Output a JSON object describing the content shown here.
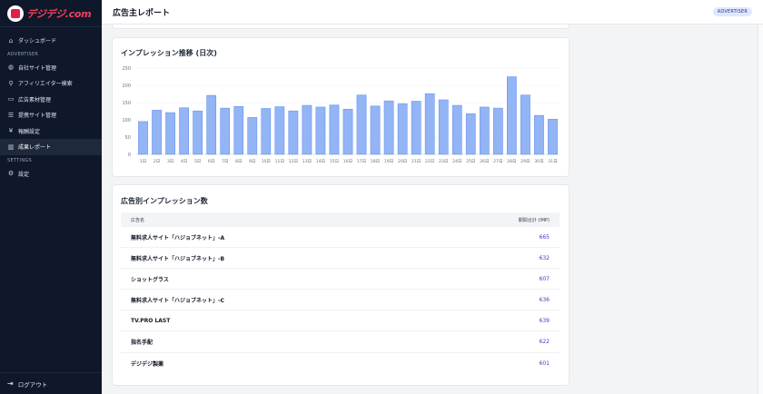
{
  "sidebar": {
    "logo_text": "デジデジ.com",
    "dashboard": "ダッシュボード",
    "section_advertiser": "ADVERTISER",
    "items": [
      {
        "label": "自社サイト管理"
      },
      {
        "label": "アフィリエイター検索"
      },
      {
        "label": "広告素材管理"
      },
      {
        "label": "提携サイト管理"
      },
      {
        "label": "報酬設定"
      },
      {
        "label": "成果レポート"
      }
    ],
    "section_settings": "SETTINGS",
    "settings": "設定",
    "logout": "ログアウト"
  },
  "header": {
    "title": "広告主レポート",
    "role_badge": "ADVERTISER"
  },
  "impressions_card": {
    "title": "インプレッション推移 (日次)"
  },
  "chart_data": {
    "type": "bar",
    "title": "インプレッション推移 (日次)",
    "categories": [
      "1日",
      "2日",
      "3日",
      "4日",
      "5日",
      "6日",
      "7日",
      "8日",
      "9日",
      "10日",
      "11日",
      "12日",
      "13日",
      "14日",
      "15日",
      "16日",
      "17日",
      "18日",
      "19日",
      "20日",
      "21日",
      "22日",
      "23日",
      "24日",
      "25日",
      "26日",
      "27日",
      "28日",
      "29日",
      "30日",
      "31日"
    ],
    "values": [
      95,
      128,
      121,
      135,
      126,
      171,
      134,
      139,
      107,
      133,
      138,
      126,
      142,
      137,
      143,
      131,
      172,
      140,
      155,
      147,
      154,
      176,
      158,
      142,
      118,
      137,
      134,
      225,
      172,
      113,
      102
    ],
    "yticks": [
      0,
      50,
      100,
      150,
      200,
      250
    ],
    "ylim": [
      0,
      250
    ],
    "bar_color": "#93b4f5",
    "bar_stroke": "#5b8def"
  },
  "ad_card": {
    "title": "広告別インプレッション数",
    "col_name": "広告名",
    "col_total": "期間合計 (IMP)",
    "rows": [
      {
        "name": "無料求人サイト「ハジョブネット」-A",
        "total": "665"
      },
      {
        "name": "無料求人サイト「ハジョブネット」-B",
        "total": "632"
      },
      {
        "name": "ショットグラス",
        "total": "607"
      },
      {
        "name": "無料求人サイト「ハジョブネット」-C",
        "total": "636"
      },
      {
        "name": "TV.PRO LAST",
        "total": "639"
      },
      {
        "name": "指名手配",
        "total": "622"
      },
      {
        "name": "デジデジ製薬",
        "total": "601"
      }
    ]
  }
}
